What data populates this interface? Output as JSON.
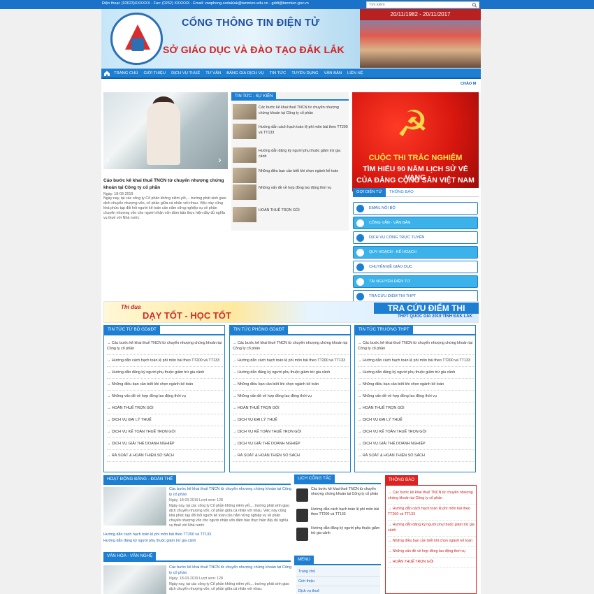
{
  "topbar": {
    "info": "Điện thoại: (02623)XXXXXX - Fax: (0262) XXXXXX - Email: vanphong.sodaklak@tanmien.edu.vn - gddt@tanmien.gov.vn",
    "search_placeholder": "Tìm kiếm"
  },
  "banner": {
    "title1": "CỔNG THÔNG TIN ĐIỆN TỬ",
    "title2": "SỞ GIÁO DỤC VÀ ĐÀO TẠO ĐẮK LẮK",
    "date": "20/11/1982 - 20/11/2017"
  },
  "nav": {
    "items": [
      "TRANG CHỦ",
      "GIỚI THIỆU",
      "DỊCH VỤ THUẾ",
      "TƯ VẤN",
      "BẢNG GIÁ DỊCH VỤ",
      "TIN TỨC",
      "TUYỂN DỤNG",
      "VĂN BẢN",
      "LIÊN HỆ"
    ]
  },
  "chao": "CHÀO M",
  "featured": {
    "title": "Cáo bước kê khai thuế TNCN từ chuyển nhượng chứng khoán tại Công ty cổ phần",
    "date": "Ngày: 18-03-2019",
    "text": "Ngày nay, tại các công ty Cổ phần không niêm yết,... trường phát sinh giao dịch chuyển nhượng vốn, cổ phần giữa cá nhân với nhau. Việc này cũng khá phức tạp đối hỏi người kê toán cần nắm vững nghiệp vụ về phần chuyển nhượng vốn cho người nhận vốn đảm bảo thực hiện đầy đủ nghĩa vụ thuế với Nhà nước"
  },
  "news": {
    "tab": "TIN TỨC - SỰ KIỆN",
    "items": [
      "Các bước kê khai thuế TNCN từ chuyển nhượng chứng khoán tại Công ty cổ phần",
      "Hướng dẫn cách hạch toán lệ phí môn bài theo TT200 và TT133",
      "Hướng dẫn đăng ký người phụ thuộc giảm trừ gia cảnh",
      "Những điều bạn cần biết khi chọn ngành kế toán",
      "Những vấn đề về hợp đồng lao động thời vụ",
      "HOÀN THUẾ TRỌN GÓI"
    ]
  },
  "poster": {
    "line1": "CUỘC THI TRẮC NGHIỆM",
    "line2": "TÌM HIỂU 90 NĂM LỊCH SỬ VẺ VANG",
    "line3": "CỦA ĐẢNG CỘNG SẢN VIỆT NAM"
  },
  "tabs2": [
    "GỢI DIỆN TỬ",
    "THÔNG BÁO"
  ],
  "quick_links": [
    "EMAIL NỘI BỘ",
    "CÔNG VĂN - VĂN BẢN",
    "DỊCH VỤ CÔNG TRỰC TUYẾN",
    "QUY HOẠCH - KẾ HOẠCH",
    "CHUYÊN ĐỀ GIÁO DỤC",
    "TÀI NGUYÊN ĐIỆN TỬ",
    "TRA CỨU ĐIỂM THI THPT"
  ],
  "ad": {
    "l1": "Thi đua",
    "l2": "DẠY TỐT - HỌC TỐT",
    "r1": "TRA CỨU ĐIỂM THI",
    "r2": "THPT QUỐC GIA 2019 TỈNH ĐẮK LẮK"
  },
  "cols": [
    {
      "title": "TIN TỨC TỪ BỘ GD&ĐT"
    },
    {
      "title": "TIN TỨC PHÒNG GD&ĐT"
    },
    {
      "title": "TIN TỨC TRƯỜNG THPT"
    }
  ],
  "col_items": [
    "→ Các bước kê khai thuế TNCN từ chuyển nhượng chứng khoán tại Công ty cổ phần",
    "→ Hướng dẫn cách hạch toán lệ phí môn bài theo TT200 và TT133",
    "→ Hướng dẫn đăng ký người phụ thuộc giảm trừ gia cảnh",
    "→ Những điều bạn cần biết khi chọn ngành kế toán",
    "→ Những vấn đề về hợp đồng lao động thời vụ",
    "→ HOÀN THUẾ TRỌN GÓI",
    "→ DỊCH VỤ ĐẠI LÝ THUẾ",
    "→ DỊCH VỤ KẾ TOÁN THUẾ TRỌN GÓI",
    "→ DỊCH VỤ GIẢI THỂ DOANH NGHIỆP",
    "→ RÀ SOÁT & HOÀN THIỆN SỔ SÁCH"
  ],
  "hd": {
    "title": "HOẠT ĐỘNG ĐẢNG - ĐOÀN THỂ",
    "item_title": "Các bước kê khai thuế TNCN từ chuyển nhượng chứng khoán tại Công ty cổ phần",
    "item_date": "Ngày: 18-03-2019  Lượt xem: 128",
    "item_text": "Ngày nay, tại các công ty Cổ phần không niêm yết,... trường phát sinh giao dịch chuyển nhượng vốn, cổ phần giữa cá nhân với nhau. Việc này cũng khá phức tạp đối hỏi người kê toán cần nắm vững nghiệp vụ về phần chuyển nhượng vốn cho người nhận vốn đảm bảo thực hiện đầy đủ nghĩa vụ thuế với Nhà nước",
    "sub1": "Hướng dẫn cách hạch toán lệ phí môn bài theo TT200 và TT133",
    "sub2": "Hướng dẫn đăng ký người phụ thuộc giảm trừ gia cảnh"
  },
  "vh": {
    "title": "VĂN HÓA - VĂN NGHỆ",
    "item_title": "Các bước kê khai thuế TNCN từ chuyển nhượng chứng khoán tại Công ty cổ phần",
    "item_date": "Ngày: 18-03-2019  Lượt xem: 128",
    "item_text": "Ngày nay, tại các công ty Cổ phần không niêm yết,... trường phát sinh giao dịch chuyển nhượng vốn, cổ phần giữa cá nhân với nhau."
  },
  "lich": {
    "title": "LỊCH CÔNG TÁC",
    "items": [
      "Các bước kê khai thuế TNCN từ chuyển nhượng chứng khoán tại Công ty cổ phần",
      "Hướng dẫn cách hạch toán lệ phí môn bài theo TT200 và TT133",
      "Hướng dẫn đăng ký người phụ thuộc giảm trừ gia cảnh"
    ]
  },
  "menu": {
    "title": "MENU",
    "items": [
      "Trang chủ",
      "Giới thiệu",
      "Dịch vụ thuế"
    ]
  },
  "thongbao": {
    "title": "THÔNG BÁO",
    "items": [
      "→ Các bước kê khai thuế TNCN từ chuyển nhượng chứng khoán tại Công ty cổ phần",
      "→ Hướng dẫn cách hạch toán lệ phí môn bài theo TT200 và TT133",
      "→ Hướng dẫn đăng ký người phụ thuộc giảm trừ gia cảnh",
      "→ Những điều bạn cần biết khi chọn ngành kế toán",
      "→ Những vấn đề về hợp đồng lao động thời vụ",
      "→ HOÀN THUẾ TRỌN GÓI"
    ]
  },
  "colors": {
    "primary": "#1d7fd1",
    "accent_red": "#d22222"
  }
}
